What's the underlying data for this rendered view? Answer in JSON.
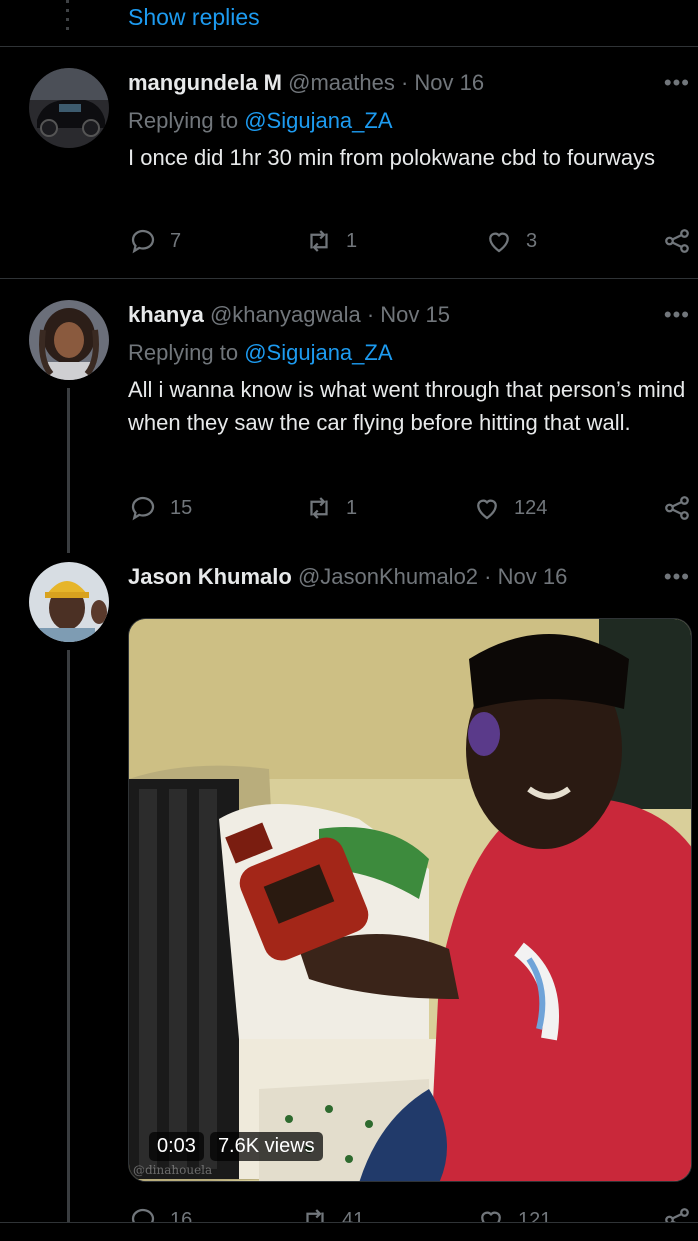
{
  "thread": {
    "show_replies_label": "Show replies"
  },
  "tweets": [
    {
      "name": "mangundela M",
      "handle": "@maathes",
      "date": "· Nov 16",
      "replying_prefix": "Replying to",
      "replying_to": "@Sigujana_ZA",
      "text": "I once did 1hr 30 min from polokwane cbd to fourways",
      "replies": "7",
      "retweets": "1",
      "likes": "3",
      "more": "•••"
    },
    {
      "name": "khanya",
      "handle": "@khanyagwala",
      "date": "· Nov 15",
      "replying_prefix": "Replying to",
      "replying_to": "@Sigujana_ZA",
      "text": "All i wanna know is what went through that person’s mind when they saw the car flying before hitting that wall.",
      "replies": "15",
      "retweets": "1",
      "likes": "124",
      "more": "•••"
    },
    {
      "name": "Jason Khumalo",
      "handle": "@JasonKhumalo2",
      "date": "· Nov 16",
      "media": {
        "duration": "0:03",
        "views": "7.6K views",
        "watermark": "@dinahouela"
      },
      "replies": "16",
      "retweets": "41",
      "likes": "121",
      "more": "•••"
    }
  ],
  "icons": {
    "reply": "reply-icon",
    "retweet": "retweet-icon",
    "like": "heart-icon",
    "share": "share-icon",
    "more": "more-icon"
  },
  "colors": {
    "background": "#000000",
    "link": "#1d9bf0",
    "muted": "#71767b",
    "text": "#e7e9ea",
    "divider": "#2f3336"
  }
}
